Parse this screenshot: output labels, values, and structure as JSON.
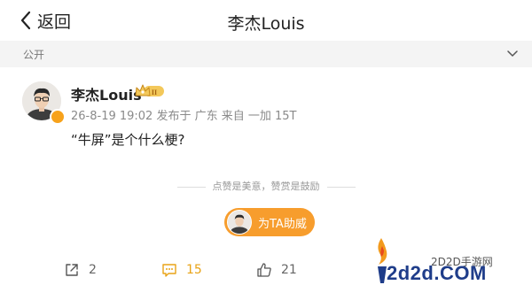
{
  "header": {
    "back_label": "返回",
    "title": "李杰Louis"
  },
  "visibility": {
    "label": "公开"
  },
  "post": {
    "username": "李杰Louis",
    "level_badge": "II",
    "meta": "26-8-19 19:02 发布于 广东  来自 一加 15T",
    "content": "“牛屏”是个什么梗?",
    "like_note": "点赞是美意，赞赏是鼓励",
    "boost_label": "为TA助威"
  },
  "actions": {
    "repost_count": "2",
    "comment_count": "15",
    "like_count": "21"
  },
  "watermark": {
    "text1": "2D2D手游网",
    "text2": "2d2d.COM"
  },
  "colors": {
    "accent_orange": "#f79d2d",
    "comment_yellow": "#e8a317",
    "brand_blue": "#1f3d8a"
  }
}
